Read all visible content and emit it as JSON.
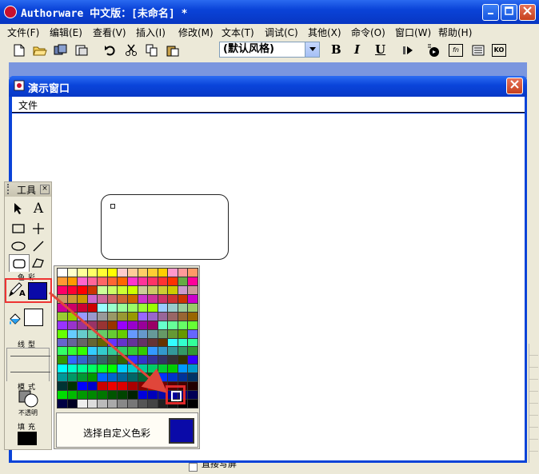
{
  "app": {
    "title": "Authorware 中文版：[未命名] *"
  },
  "menu": {
    "items": [
      "文件(F)",
      "编辑(E)",
      "查看(V)",
      "插入(I)",
      "修改(M)",
      "文本(T)",
      "调试(C)",
      "其他(X)",
      "命令(O)",
      "窗口(W)",
      "帮助(H)"
    ]
  },
  "toolbar": {
    "style_select": "(默认风格)",
    "bold": "B",
    "italic": "I",
    "underline": "U",
    "fn_label": "fn",
    "ko_label": "KO"
  },
  "demo_window": {
    "title": "演示窗口",
    "menu_file": "文件"
  },
  "tools_palette": {
    "title": "工具",
    "color_label": "色彩",
    "line_label": "线型",
    "mode_label": "模式",
    "mode_value": "不透明",
    "fill_label": "填充",
    "text_tool": "A",
    "pen_suffix": "A"
  },
  "color_popup": {
    "custom_label": "选择自定义色彩",
    "selected_color": "#0a0aa8",
    "rows": [
      [
        "#ffffff",
        "#ffffcc",
        "#ffff99",
        "#ffff66",
        "#ffff33",
        "#ffff00",
        "#ffcccc",
        "#ffcc99",
        "#ffcc66",
        "#ffcc33",
        "#ffcc00",
        "#ff99cc",
        "#ff9999",
        "#ff9966"
      ],
      [
        "#ff9933",
        "#ff9900",
        "#ff66cc",
        "#ff6699",
        "#ff6666",
        "#ff6633",
        "#ff6600",
        "#ff33cc",
        "#ff3399",
        "#ff3366",
        "#ff3333",
        "#ff3300",
        "#66aa44",
        "#ff0099"
      ],
      [
        "#ff0066",
        "#ff0033",
        "#ff0000",
        "#cc3300",
        "#ccff99",
        "#ccff66",
        "#ccff33",
        "#ccff00",
        "#cccc99",
        "#cccc66",
        "#cccc33",
        "#cccc00",
        "#cc99cc",
        "#cc9999"
      ],
      [
        "#cc9966",
        "#cc9933",
        "#cc9900",
        "#cc66cc",
        "#cc6699",
        "#cc6666",
        "#cc6633",
        "#cc6600",
        "#cc33cc",
        "#cc3399",
        "#cc3366",
        "#cc3333",
        "#cc3300",
        "#cc00cc"
      ],
      [
        "#cc0099",
        "#cc0066",
        "#cc0033",
        "#cc0000",
        "#99ffff",
        "#99ffcc",
        "#99ff99",
        "#99ff66",
        "#99ff33",
        "#99ff00",
        "#99ccff",
        "#99cccc",
        "#99cc99",
        "#99cc66"
      ],
      [
        "#99cc33",
        "#99cc00",
        "#9999ff",
        "#9999cc",
        "#999999",
        "#999966",
        "#999933",
        "#999900",
        "#9966ff",
        "#9966cc",
        "#996699",
        "#996666",
        "#996633",
        "#996600"
      ],
      [
        "#9933ff",
        "#9933cc",
        "#993399",
        "#993366",
        "#993333",
        "#993300",
        "#9900ff",
        "#9900cc",
        "#990099",
        "#990066",
        "#66ffcc",
        "#66ff99",
        "#66ff66",
        "#66ff33"
      ],
      [
        "#66ff00",
        "#66ccff",
        "#66cccc",
        "#66cc99",
        "#66cc66",
        "#66cc33",
        "#66cc00",
        "#6699ff",
        "#6699cc",
        "#669999",
        "#669966",
        "#669933",
        "#669900",
        "#6666ff"
      ],
      [
        "#6666cc",
        "#666699",
        "#666666",
        "#666633",
        "#666600",
        "#6633ff",
        "#6633cc",
        "#663399",
        "#663366",
        "#663333",
        "#663300",
        "#33ffff",
        "#33ffcc",
        "#33ff99"
      ],
      [
        "#33ff66",
        "#33ff33",
        "#33ff00",
        "#33ccff",
        "#33cccc",
        "#33cc99",
        "#33cc66",
        "#33cc33",
        "#33cc00",
        "#3399ff",
        "#3399cc",
        "#339999",
        "#339966",
        "#339933"
      ],
      [
        "#339900",
        "#3366ff",
        "#3366cc",
        "#336699",
        "#336666",
        "#336633",
        "#336600",
        "#3333ff",
        "#3333cc",
        "#333399",
        "#333366",
        "#333333",
        "#333300",
        "#3300ff"
      ],
      [
        "#00ffff",
        "#00ffcc",
        "#00ff99",
        "#00ff66",
        "#00ff33",
        "#00ff00",
        "#00ccff",
        "#00cccc",
        "#00cc99",
        "#00cc66",
        "#00cc33",
        "#00cc00",
        "#0099ff",
        "#0099cc"
      ],
      [
        "#009999",
        "#009966",
        "#009933",
        "#009900",
        "#0066ff",
        "#0066cc",
        "#006699",
        "#006666",
        "#006633",
        "#006600",
        "#0033ff",
        "#0033cc",
        "#003399",
        "#003366"
      ],
      [
        "#003333",
        "#003300",
        "#0000ff",
        "#0000cc",
        "#cc0000",
        "#ee0000",
        "#dd0000",
        "#aa0000",
        "#880000",
        "#bb0000",
        "#770000",
        "#550000",
        "#440000",
        "#220000"
      ],
      [
        "#00dd00",
        "#00bb00",
        "#009900",
        "#008800",
        "#007700",
        "#005500",
        "#004400",
        "#002200",
        "#0000dd",
        "#0000bb",
        "#0a0aa8",
        "#000099",
        "#000077",
        "#000055"
      ],
      [
        "#000044",
        "#000022",
        "#eeeeee",
        "#dddddd",
        "#bbbbbb",
        "#aaaaaa",
        "#888888",
        "#777777",
        "#555555",
        "#444444",
        "#222222",
        "#111111",
        "#000000",
        "#000000"
      ]
    ]
  },
  "bottom_option": "直接写屏"
}
